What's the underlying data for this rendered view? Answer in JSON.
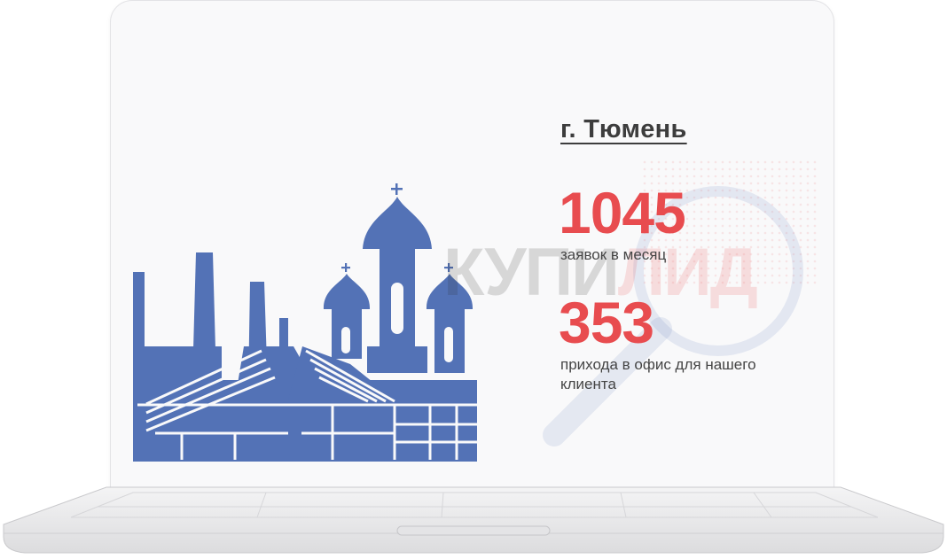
{
  "city": {
    "title": "г. Тюмень"
  },
  "stats": [
    {
      "value": "1045",
      "caption": "заявок в месяц"
    },
    {
      "value": "353",
      "caption": "прихода в офис для нашего клиента"
    }
  ],
  "watermark": {
    "part1": "КУПИ",
    "part2": "ЛИД"
  },
  "colors": {
    "accent": "#e84c4f",
    "illustration": "#5372b6",
    "text": "#3d3d3d"
  },
  "icons": [
    "tyumen-skyline-illustration",
    "magnifier-icon",
    "laptop-keyboard"
  ]
}
